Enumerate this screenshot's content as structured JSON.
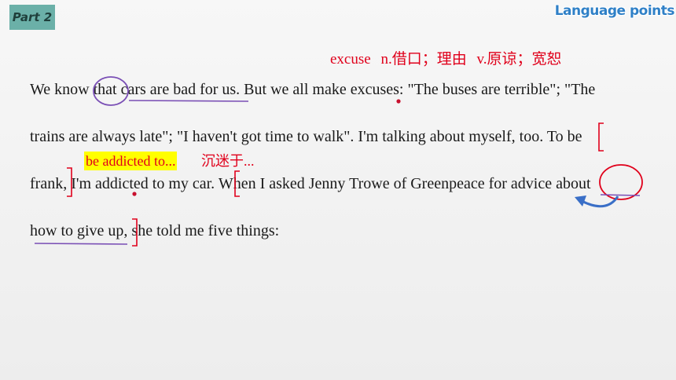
{
  "header": {
    "part_label": "Part 2",
    "section_title": "Language points"
  },
  "vocab_note": {
    "word": "excuse",
    "noun": "n.借口；理由",
    "verb": "v.原谅；宽恕"
  },
  "passage_lines": [
    "We know that cars are bad for us. But we all make excuses: \"The buses are terrible\"; \"The",
    "trains are always late\"; \"I haven't got time to walk\". I'm talking about myself, too. To be",
    "frank, I'm addicted to my car. When I asked Jenny Trowe of Greenpeace for advice about",
    "how to give up, she told me five things:"
  ],
  "phrase_note": {
    "phrase": "be addicted to...",
    "meaning": "沉迷于..."
  },
  "colors": {
    "accent_red": "#e0001b",
    "highlight_yellow": "#ffff00",
    "annotation_purple": "#7a4fb5",
    "annotation_blue": "#3a6fc7",
    "badge_teal": "#6bb0a8",
    "title_blue": "#2f80c7"
  }
}
